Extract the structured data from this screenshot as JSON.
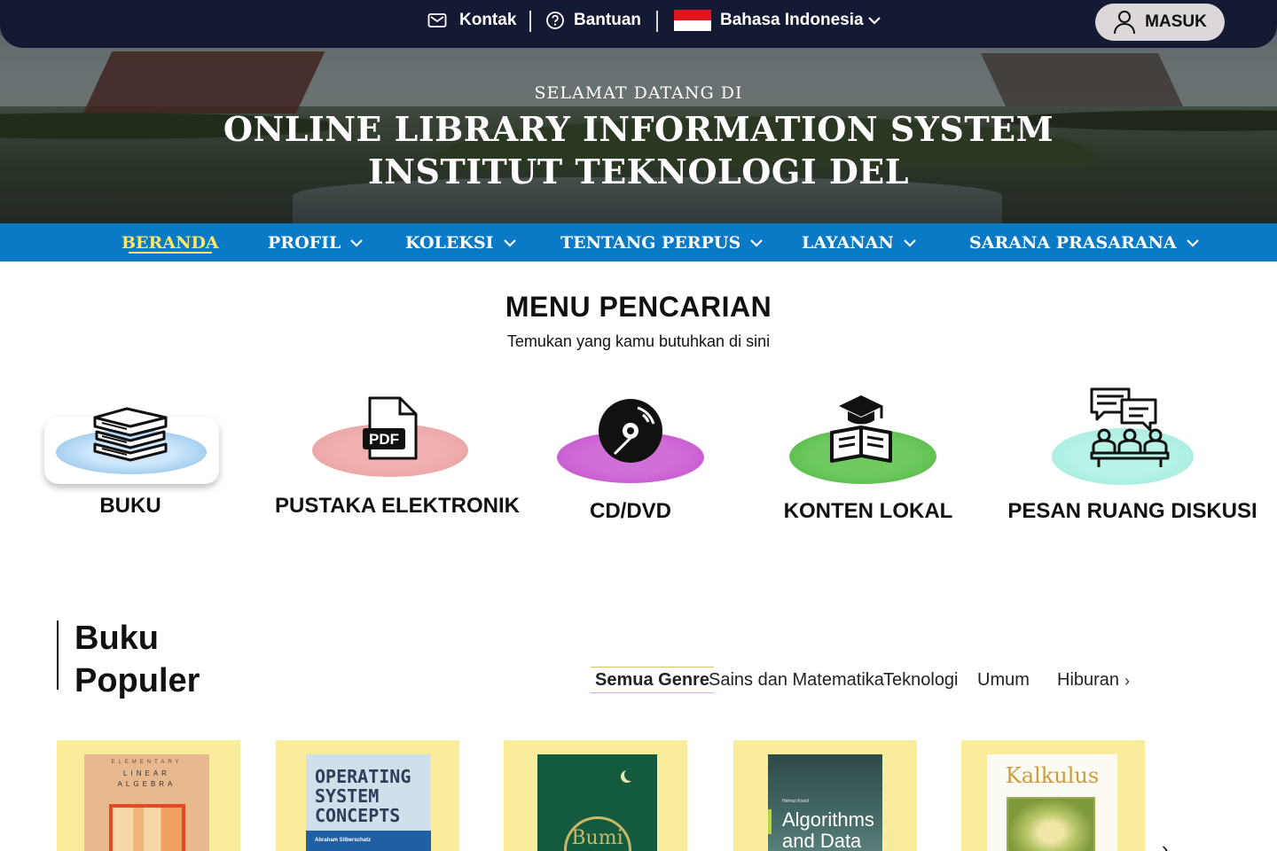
{
  "topbar": {
    "contact_label": "Kontak",
    "help_label": "Bantuan",
    "language_label": "Bahasa Indonesia",
    "login_label": "MASUK"
  },
  "hero": {
    "welcome": "SELAMAT DATANG DI",
    "title_line1": "ONLINE LIBRARY INFORMATION SYSTEM",
    "title_line2": "INSTITUT TEKNOLOGI DEL"
  },
  "nav": {
    "items": [
      {
        "label": "BERANDA",
        "active": true
      },
      {
        "label": "PROFIL"
      },
      {
        "label": "KOLEKSI"
      },
      {
        "label": "TENTANG PERPUS"
      },
      {
        "label": "LAYANAN"
      },
      {
        "label": "SARANA PRASARANA"
      }
    ]
  },
  "search_menu": {
    "title": "MENU PENCARIAN",
    "subtitle": "Temukan yang kamu butuhkan di sini",
    "categories": [
      {
        "label": "BUKU",
        "icon": "books-stack-icon",
        "color": "#b9dcf7"
      },
      {
        "label": "PUSTAKA ELEKTRONIK",
        "icon": "pdf-file-icon",
        "color": "#eaa4a4"
      },
      {
        "label": "CD/DVD",
        "icon": "disc-icon",
        "color": "#c95bd2"
      },
      {
        "label": "KONTEN LOKAL",
        "icon": "graduation-book-icon",
        "color": "#5cbc4e"
      },
      {
        "label": "PESAN RUANG DISKUSI",
        "icon": "discussion-room-icon",
        "color": "#a6eee0"
      }
    ]
  },
  "popular": {
    "title_line1": "Buku",
    "title_line2": "Populer",
    "genres": [
      "Semua Genre",
      "Sains dan Matematika",
      "Teknologi",
      "Umum",
      "Hiburan"
    ],
    "active_genre": "Semua Genre",
    "books": [
      {
        "cover_text": "LINEAR ALGEBRA",
        "cover_small": "ELEMENTARY"
      },
      {
        "cover_text": "OPERATING SYSTEM CONCEPTS",
        "cover_small": "Abraham Silberschatz"
      },
      {
        "cover_text": "Bumi",
        "cover_small": ""
      },
      {
        "cover_text": "Algorithms and Data",
        "cover_small": "Helmut Knebl"
      },
      {
        "cover_text": "Kalkulus",
        "cover_small": ""
      }
    ]
  }
}
